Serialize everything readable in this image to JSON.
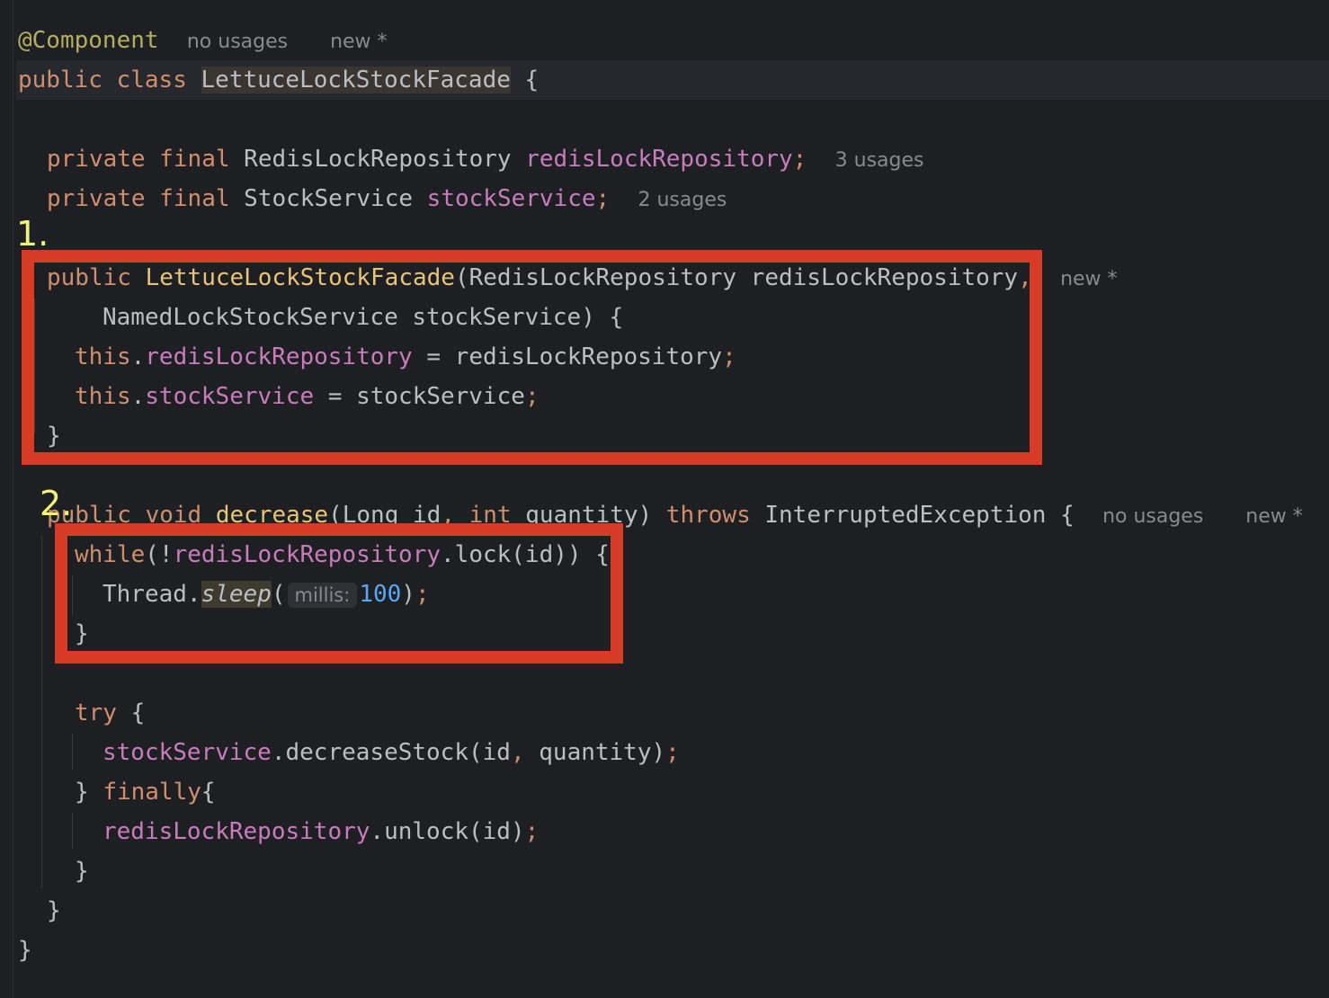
{
  "code": {
    "annotation": "@Component",
    "annotation_hint_1": "no usages",
    "annotation_hint_2": "new *",
    "class_kw_public": "public",
    "class_kw_class": "class",
    "class_name": "LettuceLockStockFacade",
    "open_brace": "{",
    "field1": {
      "kw_private": "private",
      "kw_final": "final",
      "type": "RedisLockRepository",
      "name": "redisLockRepository",
      "semi": ";",
      "hint": "3 usages"
    },
    "field2": {
      "kw_private": "private",
      "kw_final": "final",
      "type": "StockService",
      "name": "stockService",
      "semi": ";",
      "hint": "2 usages"
    },
    "ctor": {
      "kw_public": "public",
      "name": "LettuceLockStockFacade",
      "params_line1": "(RedisLockRepository redisLockRepository",
      "comma": ",",
      "hint": "new *",
      "params_line2": "NamedLockStockService stockService) {",
      "assign1_this": "this",
      "assign1_dot": ".",
      "assign1_field": "redisLockRepository",
      "assign1_rest": " = redisLockRepository",
      "assign2_this": "this",
      "assign2_dot": ".",
      "assign2_field": "stockService",
      "assign2_rest": " = stockService",
      "semi": ";",
      "close": "}"
    },
    "method": {
      "kw_public": "public",
      "kw_void": "void",
      "name": "decrease",
      "params_a": "(Long id",
      "comma": ",",
      "kw_int": "int",
      "params_b": " quantity) ",
      "kw_throws": "throws",
      "exception": " InterruptedException {",
      "hint_1": "no usages",
      "hint_2": "new *",
      "while_kw": "while",
      "while_open": "(!",
      "while_field": "redisLockRepository",
      "while_rest": ".lock(id)) {",
      "thread": "Thread.",
      "sleep": "sleep",
      "sleep_open": "(",
      "param_hint": "millis:",
      "sleep_num": "100",
      "sleep_close": ")",
      "semi": ";",
      "close_brace": "}",
      "try_kw": "try",
      "try_open": " {",
      "svc_field": "stockService",
      "svc_call": ".decreaseStock(id",
      "svc_comma": ",",
      "svc_rest": " quantity)",
      "finally_close": "} ",
      "finally_kw": "finally",
      "finally_open": "{",
      "unlock_field": "redisLockRepository",
      "unlock_rest": ".unlock(id)"
    }
  },
  "markers": {
    "one": "1.",
    "two": "2."
  },
  "colors": {
    "background": "#1e1f22",
    "highlight_box": "#d63b25",
    "marker": "#f3f37a"
  }
}
